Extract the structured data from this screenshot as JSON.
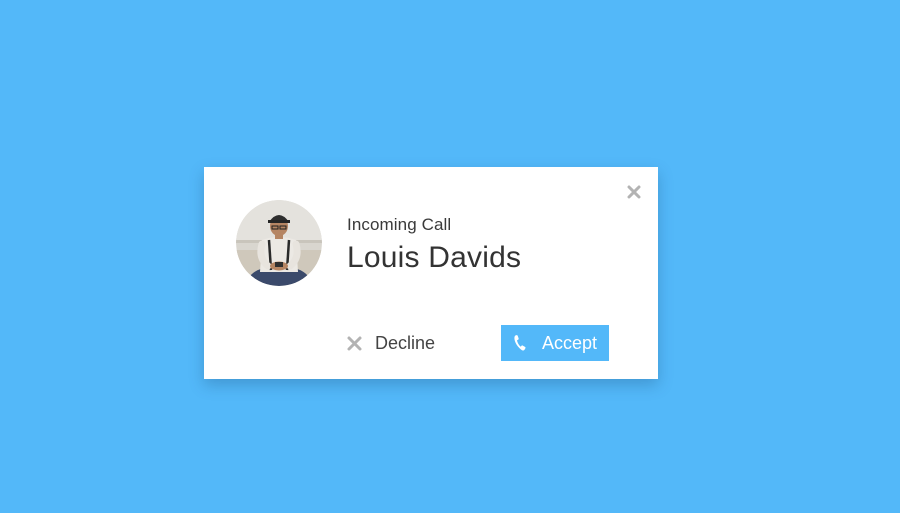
{
  "dialog": {
    "subtitle": "Incoming Call",
    "caller_name": "Louis Davids",
    "decline_label": "Decline",
    "accept_label": "Accept"
  },
  "icons": {
    "close": "close-icon",
    "decline": "close-icon",
    "accept": "phone-icon"
  },
  "colors": {
    "background": "#53b8f9",
    "accent": "#53b8f9",
    "dialog": "#ffffff",
    "icon_gray": "#b3b3b3"
  }
}
